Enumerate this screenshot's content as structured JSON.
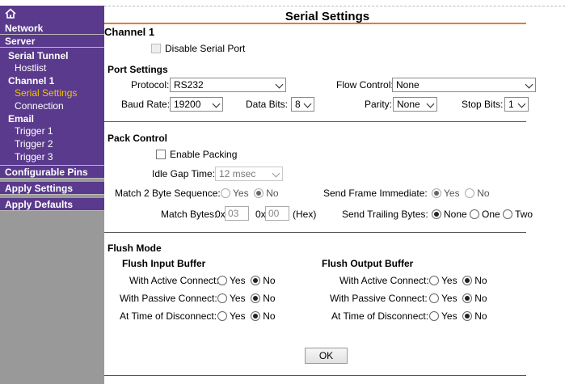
{
  "sidebar": {
    "home_icon": "home-icon",
    "network": "Network",
    "server": "Server",
    "serial_tunnel": {
      "title": "Serial Tunnel",
      "items": [
        "Hostlist"
      ]
    },
    "channel1": {
      "title": "Channel 1",
      "items": [
        "Serial Settings",
        "Connection"
      ]
    },
    "email": {
      "title": "Email",
      "items": [
        "Trigger 1",
        "Trigger 2",
        "Trigger 3"
      ]
    },
    "configurable_pins": "Configurable Pins",
    "apply_settings": "Apply Settings",
    "apply_defaults": "Apply Defaults",
    "active_color": "#f2c200",
    "nav_color": "#5a3a8c"
  },
  "page": {
    "title": "Serial Settings",
    "channel": "Channel 1",
    "disable_serial_port": "Disable Serial Port"
  },
  "port_settings": {
    "title": "Port Settings",
    "protocol_label": "Protocol:",
    "protocol_value": "RS232",
    "flow_control_label": "Flow Control:",
    "flow_control_value": "None",
    "baud_rate_label": "Baud Rate:",
    "baud_rate_value": "19200",
    "data_bits_label": "Data Bits:",
    "data_bits_value": "8",
    "parity_label": "Parity:",
    "parity_value": "None",
    "stop_bits_label": "Stop Bits:",
    "stop_bits_value": "1"
  },
  "pack_control": {
    "title": "Pack Control",
    "enable_packing": "Enable Packing",
    "idle_gap_label": "Idle Gap Time:",
    "idle_gap_value": "12 msec",
    "match2_label": "Match 2 Byte Sequence:",
    "match2_yes": "Yes",
    "match2_no": "No",
    "send_frame_label": "Send Frame Immediate:",
    "send_frame_yes": "Yes",
    "send_frame_no": "No",
    "match_bytes_label": "Match Bytes:",
    "match_prefix": "0x",
    "match_byte1": "03",
    "match_byte2": "00",
    "hex_label": "(Hex)",
    "trailing_label": "Send Trailing Bytes:",
    "trailing_none": "None",
    "trailing_one": "One",
    "trailing_two": "Two"
  },
  "flush_mode": {
    "title": "Flush Mode",
    "input_title": "Flush Input Buffer",
    "output_title": "Flush Output Buffer",
    "active_label": "With Active Connect:",
    "passive_label": "With Passive Connect:",
    "disconnect_label": "At Time of Disconnect:",
    "yes": "Yes",
    "no": "No"
  },
  "ok_button": "OK",
  "accent_color": "#e87a2a"
}
